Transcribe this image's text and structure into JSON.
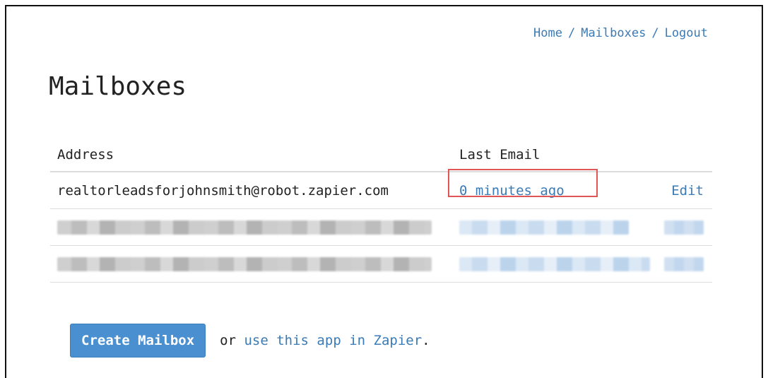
{
  "breadcrumb": {
    "home": "Home",
    "mailboxes": "Mailboxes",
    "logout": "Logout",
    "separator": "/"
  },
  "page": {
    "title": "Mailboxes"
  },
  "table": {
    "headers": {
      "address": "Address",
      "last_email": "Last Email"
    },
    "rows": [
      {
        "address": "realtorleadsforjohnsmith@robot.zapier.com",
        "last_email": "0 minutes ago",
        "edit": "Edit"
      }
    ]
  },
  "actions": {
    "create_label": "Create Mailbox",
    "or_text": "or",
    "link_text": "use this app in Zapier",
    "period": "."
  },
  "colors": {
    "link": "#3a7ab5",
    "button": "#4a8fcf",
    "highlight": "#e05656"
  }
}
